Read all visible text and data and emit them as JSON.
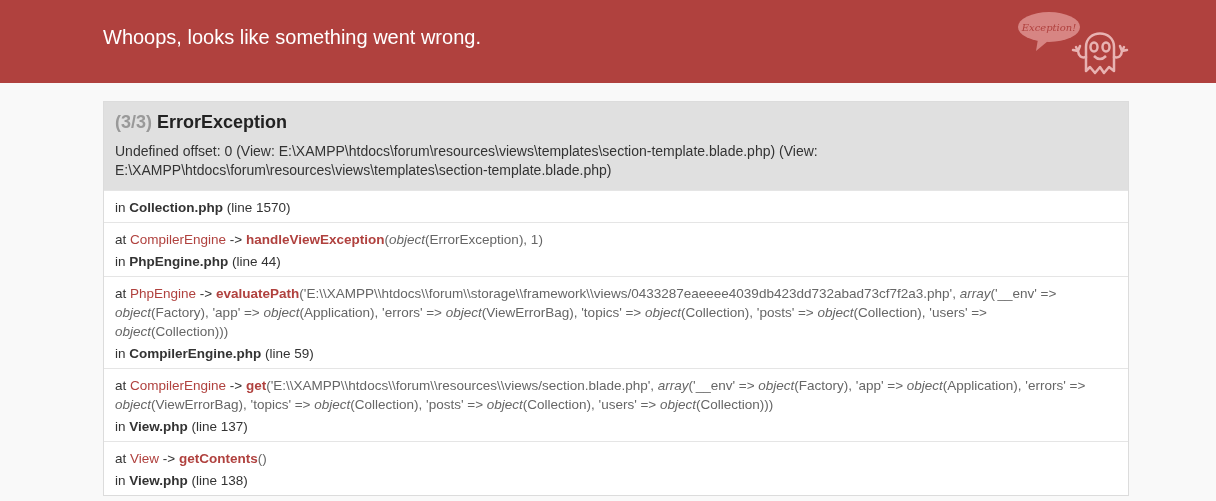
{
  "header": {
    "title": "Whoops, looks like something went wrong.",
    "logo_text": "Exception!"
  },
  "exception": {
    "counter": "(3/3)",
    "name": "ErrorException",
    "message": "Undefined offset: 0 (View: E:\\XAMPP\\htdocs\\forum\\resources\\views\\templates\\section-template.blade.php) (View: E:\\XAMPP\\htdocs\\forum\\resources\\views\\templates\\section-template.blade.php)"
  },
  "frames": [
    {
      "location": "in **Collection.php** (line 1570)"
    },
    {
      "call": {
        "prefix": "at",
        "class": "CompilerEngine",
        "arrow": "->",
        "method": "handleViewException",
        "args": "(*object*(ErrorException), 1)"
      },
      "location": "in **PhpEngine.php** (line 44)"
    },
    {
      "call": {
        "prefix": "at",
        "class": "PhpEngine",
        "arrow": "->",
        "method": "evaluatePath",
        "args": "('E:\\\\XAMPP\\\\htdocs\\\\forum\\\\storage\\\\framework\\\\views/0433287eaeeee4039db423dd732abad73cf7f2a3.php', *array*('__env' => *object*(Factory), 'app' => *object*(Application), 'errors' => *object*(ViewErrorBag), 'topics' => *object*(Collection), 'posts' => *object*(Collection), 'users' => *object*(Collection)))"
      },
      "location": "in **CompilerEngine.php** (line 59)"
    },
    {
      "call": {
        "prefix": "at",
        "class": "CompilerEngine",
        "arrow": "->",
        "method": "get",
        "args": "('E:\\\\XAMPP\\\\htdocs\\\\forum\\\\resources\\\\views/section.blade.php', *array*('__env' => *object*(Factory), 'app' => *object*(Application), 'errors' => *object*(ViewErrorBag), 'topics' => *object*(Collection), 'posts' => *object*(Collection), 'users' => *object*(Collection)))"
      },
      "location": "in **View.php** (line 137)"
    },
    {
      "call": {
        "prefix": "at",
        "class": "View",
        "arrow": "->",
        "method": "getContents",
        "args": "()"
      },
      "location": "in **View.php** (line 138)"
    }
  ]
}
